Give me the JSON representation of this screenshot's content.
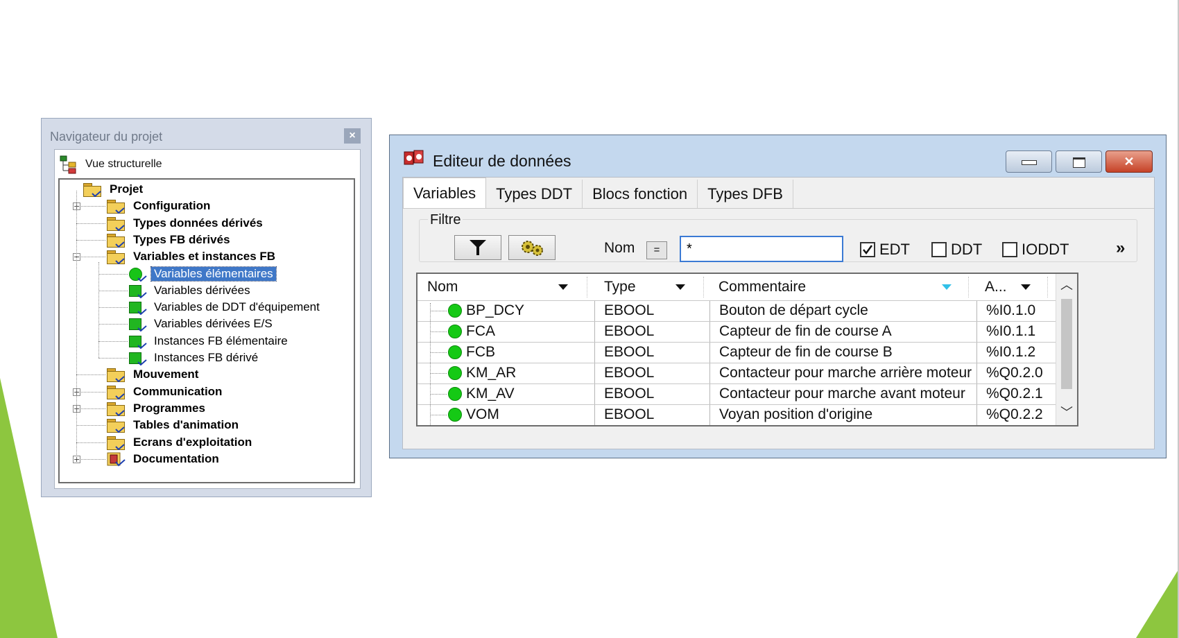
{
  "navigator": {
    "title": "Navigateur du projet",
    "close_label": "×",
    "view_label": "Vue structurelle",
    "tree": [
      {
        "label": "Projet",
        "bold": true,
        "level": 0,
        "icon": "open-folder-icon",
        "expander": ""
      },
      {
        "label": "Configuration",
        "bold": true,
        "level": 1,
        "icon": "folder-icon",
        "expander": "+"
      },
      {
        "label": "Types données dérivés",
        "bold": true,
        "level": 1,
        "icon": "folder-icon",
        "expander": ""
      },
      {
        "label": "Types FB dérivés",
        "bold": true,
        "level": 1,
        "icon": "folder-icon",
        "expander": ""
      },
      {
        "label": "Variables et instances FB",
        "bold": true,
        "level": 1,
        "icon": "open-folder-icon",
        "expander": "−"
      },
      {
        "label": "Variables élémentaires",
        "bold": false,
        "level": 2,
        "icon": "elementary-variable-icon",
        "expander": "",
        "selected": true
      },
      {
        "label": "Variables dérivées",
        "bold": false,
        "level": 2,
        "icon": "derived-variable-icon",
        "expander": ""
      },
      {
        "label": "Variables de DDT d'équipement",
        "bold": false,
        "level": 2,
        "icon": "device-ddt-icon",
        "expander": ""
      },
      {
        "label": "Variables dérivées E/S",
        "bold": false,
        "level": 2,
        "icon": "io-derived-icon",
        "expander": ""
      },
      {
        "label": "Instances FB élémentaire",
        "bold": false,
        "level": 2,
        "icon": "fb-instance-icon",
        "expander": ""
      },
      {
        "label": "Instances FB dérivé",
        "bold": false,
        "level": 2,
        "icon": "fb-derived-icon",
        "expander": ""
      },
      {
        "label": "Mouvement",
        "bold": true,
        "level": 1,
        "icon": "folder-icon",
        "expander": ""
      },
      {
        "label": "Communication",
        "bold": true,
        "level": 1,
        "icon": "folder-icon",
        "expander": "+"
      },
      {
        "label": "Programmes",
        "bold": true,
        "level": 1,
        "icon": "folder-icon",
        "expander": "+"
      },
      {
        "label": "Tables d'animation",
        "bold": true,
        "level": 1,
        "icon": "folder-icon",
        "expander": ""
      },
      {
        "label": "Ecrans d'exploitation",
        "bold": true,
        "level": 1,
        "icon": "folder-icon",
        "expander": ""
      },
      {
        "label": "Documentation",
        "bold": true,
        "level": 1,
        "icon": "documentation-icon",
        "expander": "+"
      }
    ]
  },
  "editor": {
    "title": "Editeur de données",
    "tabs": [
      "Variables",
      "Types DDT",
      "Blocs fonction",
      "Types DFB"
    ],
    "active_tab": 0,
    "filter_label": "Filtre",
    "nom_label": "Nom",
    "eq_label": "=",
    "name_value": "*",
    "checkboxes": [
      {
        "label": "EDT",
        "checked": true
      },
      {
        "label": "DDT",
        "checked": false
      },
      {
        "label": "IODDT",
        "checked": false
      }
    ],
    "more_label": "»",
    "columns": [
      "Nom",
      "Type",
      "Commentaire",
      "A..."
    ],
    "rows": [
      {
        "name": "BP_DCY",
        "type": "EBOOL",
        "comment": "Bouton de départ cycle",
        "address": "%I0.1.0"
      },
      {
        "name": "FCA",
        "type": "EBOOL",
        "comment": "Capteur de fin de course A",
        "address": "%I0.1.1"
      },
      {
        "name": "FCB",
        "type": "EBOOL",
        "comment": "Capteur de fin de course B",
        "address": "%I0.1.2"
      },
      {
        "name": "KM_AR",
        "type": "EBOOL",
        "comment": "Contacteur pour marche arrière moteur",
        "address": "%Q0.2.0"
      },
      {
        "name": "KM_AV",
        "type": "EBOOL",
        "comment": "Contacteur pour marche avant moteur",
        "address": "%Q0.2.1"
      },
      {
        "name": "VOM",
        "type": "EBOOL",
        "comment": "Voyan position d'origine",
        "address": "%Q0.2.2"
      }
    ]
  },
  "colors": {
    "accent_green": "#8dc63f",
    "selection_blue": "#3f78c8",
    "status_green": "#15c915"
  }
}
